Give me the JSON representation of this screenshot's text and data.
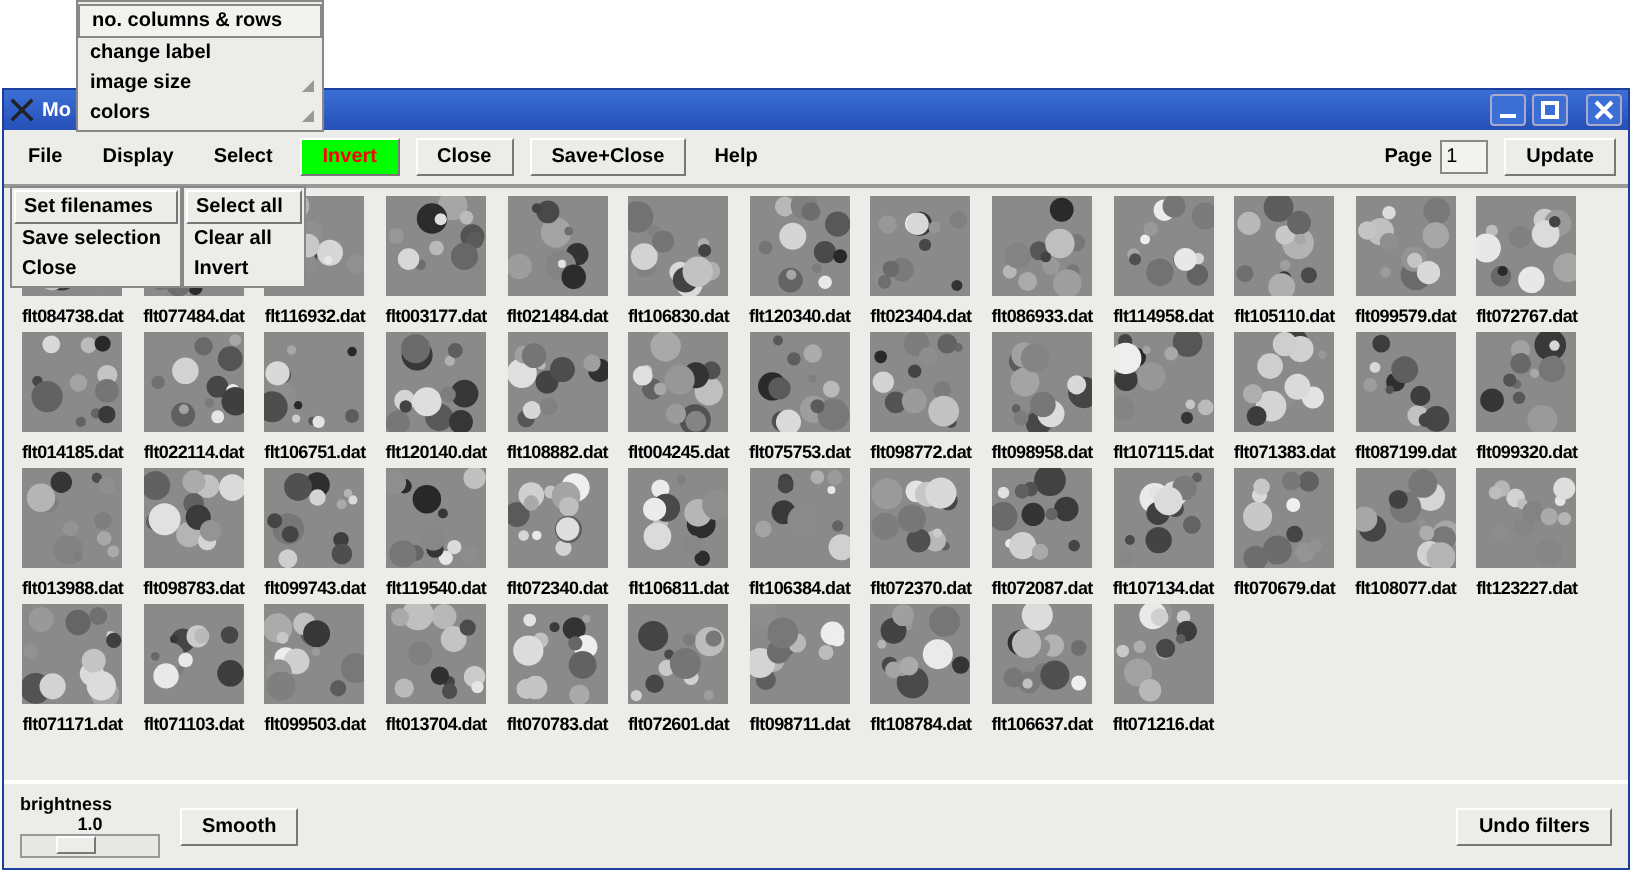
{
  "context_menu": {
    "items": [
      {
        "label": "no. columns & rows",
        "submenu": false,
        "selected": true
      },
      {
        "label": "change label",
        "submenu": false,
        "selected": false
      },
      {
        "label": "image size",
        "submenu": true,
        "selected": false
      },
      {
        "label": "colors",
        "submenu": true,
        "selected": false
      }
    ]
  },
  "window": {
    "title": "Mo"
  },
  "menubar": [
    {
      "label": "File",
      "kind": "menu"
    },
    {
      "label": "Display",
      "kind": "menu"
    },
    {
      "label": "Select",
      "kind": "menu"
    },
    {
      "label": "Invert",
      "kind": "toggle",
      "on": true
    },
    {
      "label": "Close",
      "kind": "button"
    },
    {
      "label": "Save+Close",
      "kind": "button"
    },
    {
      "label": "Help",
      "kind": "menu"
    }
  ],
  "page": {
    "label": "Page",
    "value": "1",
    "button": "Update"
  },
  "file_menu": [
    {
      "label": "Set filenames",
      "selected": true
    },
    {
      "label": "Save selection",
      "selected": false
    },
    {
      "label": "Close",
      "selected": false
    }
  ],
  "select_menu": [
    {
      "label": "Select all",
      "selected": true
    },
    {
      "label": "Clear all",
      "selected": false
    },
    {
      "label": "Invert",
      "selected": false
    }
  ],
  "thumbnails": [
    {
      "label": "flt084738.dat"
    },
    {
      "label": "flt077484.dat"
    },
    {
      "label": "flt116932.dat"
    },
    {
      "label": "flt003177.dat"
    },
    {
      "label": "flt021484.dat"
    },
    {
      "label": "flt106830.dat"
    },
    {
      "label": "flt120340.dat"
    },
    {
      "label": "flt023404.dat"
    },
    {
      "label": "flt086933.dat"
    },
    {
      "label": "flt114958.dat"
    },
    {
      "label": "flt105110.dat"
    },
    {
      "label": "flt099579.dat"
    },
    {
      "label": "flt072767.dat"
    },
    {
      "label": "flt014185.dat"
    },
    {
      "label": "flt022114.dat"
    },
    {
      "label": "flt106751.dat"
    },
    {
      "label": "flt120140.dat"
    },
    {
      "label": "flt108882.dat"
    },
    {
      "label": "flt004245.dat"
    },
    {
      "label": "flt075753.dat"
    },
    {
      "label": "flt098772.dat"
    },
    {
      "label": "flt098958.dat"
    },
    {
      "label": "flt107115.dat"
    },
    {
      "label": "flt071383.dat"
    },
    {
      "label": "flt087199.dat"
    },
    {
      "label": "flt099320.dat"
    },
    {
      "label": "flt013988.dat"
    },
    {
      "label": "flt098783.dat"
    },
    {
      "label": "flt099743.dat"
    },
    {
      "label": "flt119540.dat"
    },
    {
      "label": "flt072340.dat"
    },
    {
      "label": "flt106811.dat"
    },
    {
      "label": "flt106384.dat"
    },
    {
      "label": "flt072370.dat"
    },
    {
      "label": "flt072087.dat"
    },
    {
      "label": "flt107134.dat"
    },
    {
      "label": "flt070679.dat"
    },
    {
      "label": "flt108077.dat"
    },
    {
      "label": "flt123227.dat"
    },
    {
      "label": "flt071171.dat"
    },
    {
      "label": "flt071103.dat"
    },
    {
      "label": "flt099503.dat"
    },
    {
      "label": "flt013704.dat"
    },
    {
      "label": "flt070783.dat"
    },
    {
      "label": "flt072601.dat"
    },
    {
      "label": "flt098711.dat"
    },
    {
      "label": "flt108784.dat"
    },
    {
      "label": "flt106637.dat"
    },
    {
      "label": "flt071216.dat"
    }
  ],
  "bottom": {
    "brightness_label": "brightness",
    "brightness_value": "1.0",
    "level": 0.4,
    "smooth": "Smooth",
    "undo": "Undo filters"
  }
}
